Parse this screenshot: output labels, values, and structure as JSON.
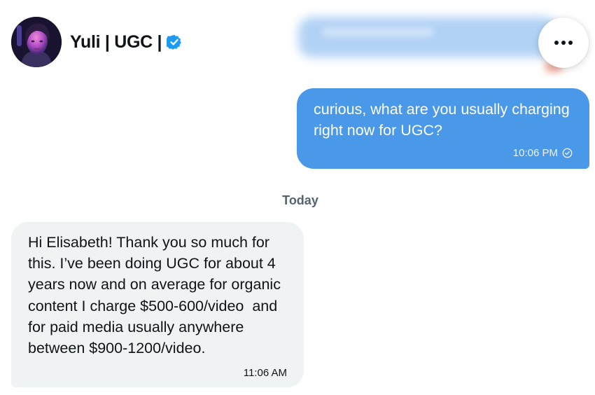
{
  "header": {
    "contact_name": "Yuli | UGC |",
    "verified": true,
    "avatar_icon": "profile-photo",
    "more_icon": "more-horizontal-icon"
  },
  "conversation": {
    "outgoing": {
      "text": "curious, what are you usually charging right now for UGC?",
      "time": "10:06 PM",
      "status_icon": "sent-check-icon"
    },
    "date_separator": "Today",
    "incoming": {
      "text": "Hi Elisabeth! Thank you so much for this. I’ve been doing UGC for about 4 years now and on average for organic content I charge $500-600/video  and for paid media usually anywhere between $900-1200/video.",
      "time": "11:06 AM"
    }
  },
  "colors": {
    "accent": "#4a99e9",
    "incoming_bubble": "#eff3f4",
    "verified_badge": "#1d9bf0",
    "secondary_text": "#536471"
  }
}
